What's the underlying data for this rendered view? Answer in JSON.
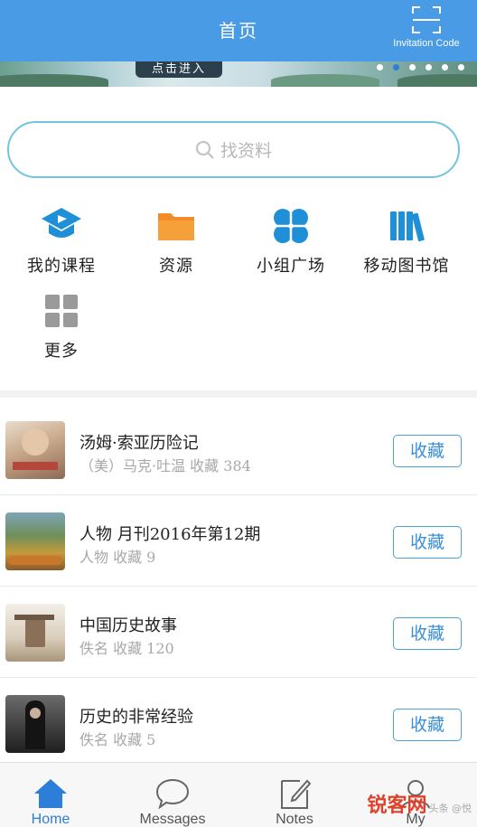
{
  "header": {
    "title": "首页",
    "invitation_label": "Invitation Code"
  },
  "banner": {
    "button_text": "点击进入",
    "dots": 6,
    "active_dot": 1
  },
  "search": {
    "placeholder": "找资料"
  },
  "grid": [
    {
      "label": "我的课程",
      "icon": "course-icon"
    },
    {
      "label": "资源",
      "icon": "folder-icon"
    },
    {
      "label": "小组广场",
      "icon": "group-icon"
    },
    {
      "label": "移动图书馆",
      "icon": "library-icon"
    },
    {
      "label": "更多",
      "icon": "more-grid-icon"
    }
  ],
  "list": [
    {
      "title": "汤姆·索亚历险记",
      "meta": "（美）马克·吐温  收藏 384",
      "fav": "收藏"
    },
    {
      "title": "人物 月刊2016年第12期",
      "meta": "人物  收藏 9",
      "fav": "收藏"
    },
    {
      "title": "中国历史故事",
      "meta": "佚名  收藏 120",
      "fav": "收藏"
    },
    {
      "title": "历史的非常经验",
      "meta": "佚名  收藏 5",
      "fav": "收藏"
    }
  ],
  "tabs": [
    {
      "label": "Home",
      "icon": "home-icon",
      "active": true
    },
    {
      "label": "Messages",
      "icon": "chat-icon"
    },
    {
      "label": "Notes",
      "icon": "note-icon"
    },
    {
      "label": "My",
      "icon": "user-icon"
    }
  ],
  "watermark": {
    "text": "锐客网",
    "sub": "头条 @悦"
  },
  "colors": {
    "header": "#4a9be6",
    "accent": "#2d7ed8",
    "search_border": "#71c4de"
  }
}
